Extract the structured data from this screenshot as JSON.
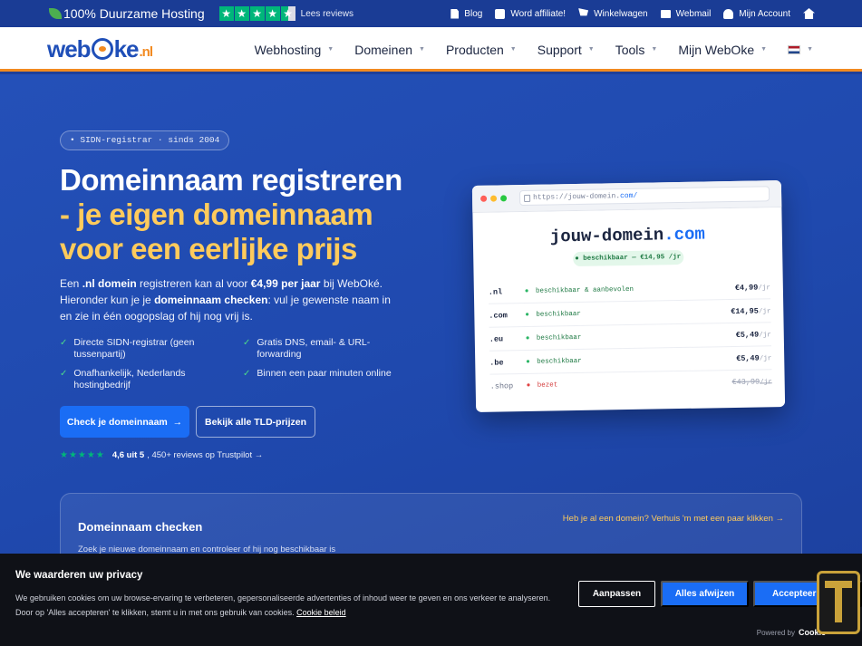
{
  "topbar": {
    "title": "100% Duurzame Hosting",
    "reviews_link": "Lees reviews",
    "stars": 4.5,
    "links": [
      {
        "icon": "document-icon",
        "label": "Blog"
      },
      {
        "icon": "camera-icon",
        "label": "Word affiliate!"
      },
      {
        "icon": "cart-icon",
        "label": "Winkelwagen"
      },
      {
        "icon": "mail-icon",
        "label": "Webmail"
      },
      {
        "icon": "user-icon",
        "label": "Mijn Account"
      }
    ],
    "home_icon": "home-icon"
  },
  "nav": {
    "logo": {
      "part1": "web",
      "part2": "ke",
      "suffix": ".nl"
    },
    "items": [
      "Webhosting",
      "Domeinen",
      "Producten",
      "Support",
      "Tools",
      "Mijn WebOke"
    ],
    "language_flag": "netherlands-flag"
  },
  "hero": {
    "badge": "• SIDN-registrar · sinds 2004",
    "title_line1": "Domeinnaam registreren",
    "title_accent_1": "- je eigen domeinnaam",
    "title_accent_2": "voor een eerlijke prijs",
    "lead": {
      "t1": "Een ",
      "b1": ".nl domein",
      "t2": " registreren kan al voor ",
      "b2": "€4,99 per jaar",
      "t3": " bij WebOké. Hieronder kun je je ",
      "b3": "domeinnaam checken",
      "t4": ": vul je gewenste naam in en zie in één oogopslag of hij nog vrij is."
    },
    "checks": [
      "Directe SIDN-registrar (geen tussenpartij)",
      "Gratis DNS, email- & URL-forwarding",
      "Onafhankelijk, Nederlands hostingbedrijf",
      "Binnen een paar minuten online"
    ],
    "primary_button": "Check je domeinnaam",
    "secondary_button": "Bekijk alle TLD-prijzen",
    "rating": {
      "stars": "★★★★★",
      "score": "4,6 uit 5",
      "rest": ", 450+ reviews op Trustpilot →"
    }
  },
  "browser": {
    "url_base": "https://jouw-domein.",
    "url_tld": "com/",
    "domain_name": "jouw-domein",
    "domain_tld": ".com",
    "available_pill": "● beschikbaar — €14,95 /jr",
    "rows": [
      {
        "tld": ".nl",
        "status": "beschikbaar & aanbevolen",
        "price": "€4,99",
        "per": "/jr",
        "taken": false
      },
      {
        "tld": ".com",
        "status": "beschikbaar",
        "price": "€14,95",
        "per": "/jr",
        "taken": false
      },
      {
        "tld": ".eu",
        "status": "beschikbaar",
        "price": "€5,49",
        "per": "/jr",
        "taken": false
      },
      {
        "tld": ".be",
        "status": "beschikbaar",
        "price": "€5,49",
        "per": "/jr",
        "taken": false
      },
      {
        "tld": ".shop",
        "status": "bezet",
        "price": "€43,99",
        "per": "/jr",
        "taken": true
      }
    ]
  },
  "checker": {
    "title": "Domeinnaam checken",
    "subtitle": "Zoek je nieuwe domeinnaam en controleer of hij nog beschikbaar is",
    "transfer_link": "Heb je al een domein? Verhuis 'm met een paar klikken →"
  },
  "cookie": {
    "title": "We waarderen uw privacy",
    "text": "We gebruiken cookies om uw browse-ervaring te verbeteren, gepersonaliseerde advertenties of inhoud weer te geven en ons verkeer te analyseren. Door op 'Alles accepteren' te klikken, stemt u in met ons gebruik van cookies.",
    "policy_link": "Cookie beleid",
    "customize_button": "Aanpassen",
    "reject_button": "Alles afwijzen",
    "accept_button": "Accepteer alles",
    "powered_by": "Powered by",
    "powered_brand": "Cookie"
  },
  "colors": {
    "brand_blue": "#1f4fb8",
    "accent_orange": "#f28a20",
    "hero_accent": "#ffcb5c",
    "button_blue": "#1a6df5",
    "trustpilot_green": "#00b67a"
  }
}
